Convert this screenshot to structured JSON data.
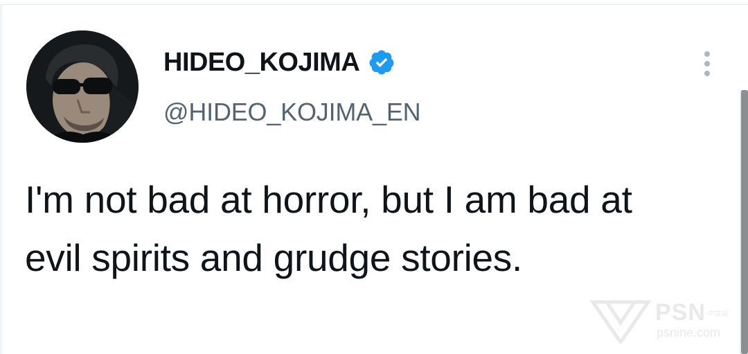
{
  "tweet": {
    "display_name": "HIDEO_KOJIMA",
    "handle": "@HIDEO_KOJIMA_EN",
    "verified": true,
    "text": "I'm not bad at horror, but I am bad at evil spirits and grudge stories."
  },
  "icons": {
    "verified": "verified-badge-icon",
    "more": "more-vertical-icon",
    "avatar": "profile-photo"
  },
  "watermark": {
    "brand": "PSN",
    "subtitle": "中文站",
    "url": "psnine.com"
  },
  "colors": {
    "accent": "#1d9bf0",
    "text_primary": "#0f1419",
    "text_secondary": "#536471",
    "more_dots": "#aab8c2"
  }
}
